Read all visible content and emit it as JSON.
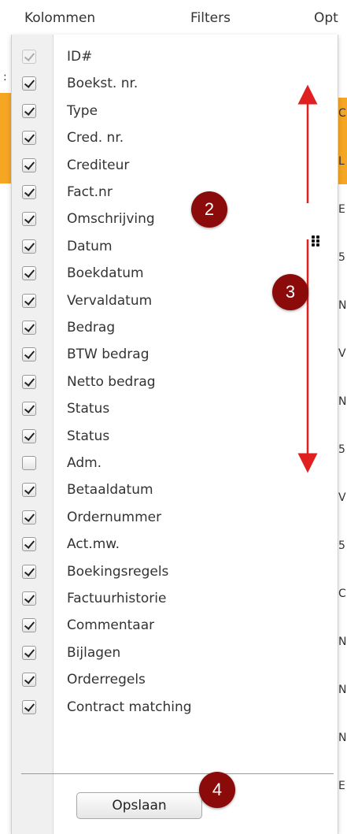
{
  "menubar": {
    "items": [
      "Kolommen",
      "Filters",
      "Opt"
    ]
  },
  "columns": [
    {
      "label": "ID#",
      "checked": true,
      "disabled": true
    },
    {
      "label": "Boekst. nr.",
      "checked": true
    },
    {
      "label": "Type",
      "checked": true
    },
    {
      "label": "Cred. nr.",
      "checked": true
    },
    {
      "label": "Crediteur",
      "checked": true
    },
    {
      "label": "Fact.nr",
      "checked": true
    },
    {
      "label": "Omschrijving",
      "checked": true
    },
    {
      "label": "Datum",
      "checked": true
    },
    {
      "label": "Boekdatum",
      "checked": true
    },
    {
      "label": "Vervaldatum",
      "checked": true
    },
    {
      "label": "Bedrag",
      "checked": true
    },
    {
      "label": "BTW bedrag",
      "checked": true
    },
    {
      "label": "Netto bedrag",
      "checked": true
    },
    {
      "label": "Status",
      "checked": true
    },
    {
      "label": "Status",
      "checked": true
    },
    {
      "label": "Adm.",
      "checked": false
    },
    {
      "label": "Betaaldatum",
      "checked": true
    },
    {
      "label": "Ordernummer",
      "checked": true
    },
    {
      "label": "Act.mw.",
      "checked": true
    },
    {
      "label": "Boekingsregels",
      "checked": true
    },
    {
      "label": "Factuurhistorie",
      "checked": true
    },
    {
      "label": "Commentaar",
      "checked": true
    },
    {
      "label": "Bijlagen",
      "checked": true
    },
    {
      "label": "Orderregels",
      "checked": true
    },
    {
      "label": "Contract matching",
      "checked": true
    }
  ],
  "save_label": "Opslaan",
  "badges": [
    "2",
    "3",
    "4"
  ],
  "background_letters": [
    "C",
    "L",
    "E",
    "5",
    "N",
    "V",
    "N",
    "5",
    "V",
    "5",
    "C",
    "N",
    "N",
    "N",
    "E"
  ],
  "drag_icon": "grip-dots-icon",
  "colors": {
    "badge": "#8b0a0a",
    "arrow": "#e02020",
    "highlight_row": "#f5a623"
  }
}
